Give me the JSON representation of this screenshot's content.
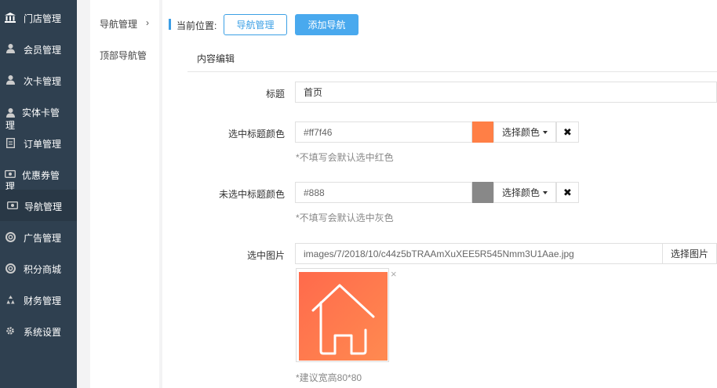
{
  "sidebar": {
    "items": [
      {
        "label": "门店管理",
        "icon": "bank-icon"
      },
      {
        "label": "会员管理",
        "icon": "user-icon"
      },
      {
        "label": "次卡管理",
        "icon": "user-icon"
      },
      {
        "label": "实体卡管",
        "label2": "理",
        "icon": "user-icon"
      },
      {
        "label": "订单管理",
        "icon": "document-icon"
      },
      {
        "label": "优惠券管",
        "label2": "理",
        "icon": "ticket-icon"
      },
      {
        "label": "导航管理",
        "icon": "ticket-icon"
      },
      {
        "label": "广告管理",
        "icon": "lifebuoy-icon"
      },
      {
        "label": "积分商城",
        "icon": "lifebuoy-icon"
      },
      {
        "label": "财务管理",
        "icon": "recycle-icon"
      },
      {
        "label": "系统设置",
        "icon": "gear-icon"
      }
    ]
  },
  "submenu": {
    "items": [
      {
        "label": "导航管理"
      },
      {
        "label": "顶部导航管"
      }
    ],
    "arrow": "›"
  },
  "breadcrumb": {
    "label": "当前位置:",
    "nav_button": "导航管理",
    "add_button": "添加导航"
  },
  "section": {
    "title": "内容编辑"
  },
  "form": {
    "title_label": "标题",
    "title_value": "首页",
    "selected_color_label": "选中标题颜色",
    "selected_color_value": "#ff7f46",
    "selected_color_hint": "*不填写会默认选中红色",
    "unselected_color_label": "未选中标题颜色",
    "unselected_color_value": "#888",
    "unselected_color_hint": "*不填写会默认选中灰色",
    "pick_color_label": "选择颜色",
    "clear_symbol": "✖",
    "image_label": "选中图片",
    "image_path": "images/7/2018/10/c44z5bTRAAmXuXEE5R545Nmm3U1Aae.jpg",
    "pick_image_label": "选择图片",
    "image_remove": "×",
    "image_hint": "*建议宽高80*80"
  },
  "colors": {
    "sidebar_bg": "#2f4050",
    "accent": "#49a9ee",
    "selected_swatch": "#ff7f46",
    "unselected_swatch": "#888888"
  }
}
